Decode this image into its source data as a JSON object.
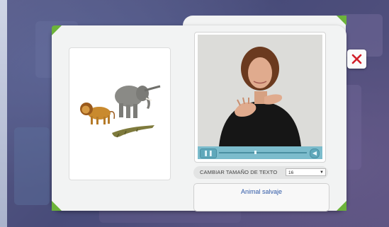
{
  "modal": {
    "image_alt": "lion, elephant and crocodile",
    "text_size": {
      "label": "CAMBIAR TAMAÑO DE TEXTO",
      "selected": "16",
      "options": [
        "16"
      ]
    },
    "caption": "Animal salvaje"
  },
  "video": {
    "progress": 0.4
  },
  "colors": {
    "accent_green": "#6cb33a",
    "close_red": "#d11f2a",
    "caption_blue": "#2e58a6",
    "player_blue": "#7cbccc"
  },
  "icons": [
    "close-icon",
    "play-icon",
    "volume-icon"
  ]
}
